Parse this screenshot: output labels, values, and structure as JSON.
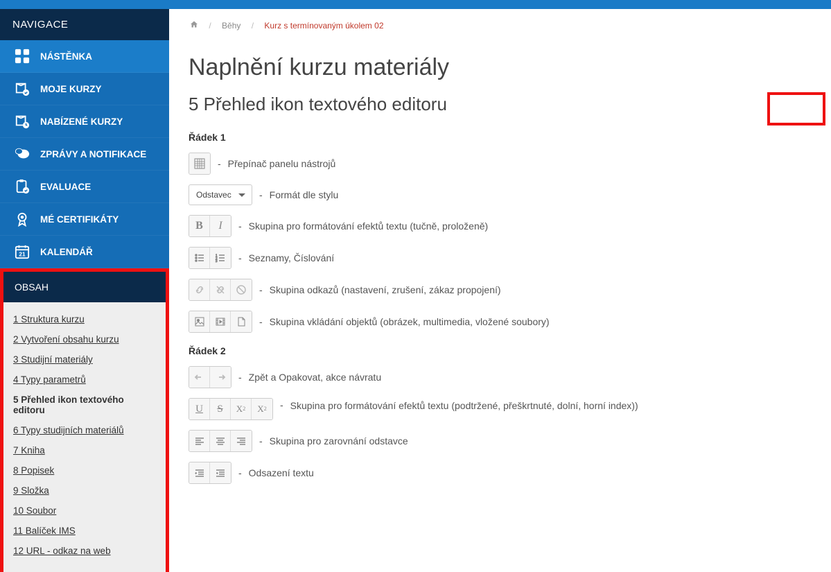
{
  "nav": {
    "title": "NAVIGACE",
    "items": [
      {
        "label": "NÁSTĚNKA",
        "icon": "grid"
      },
      {
        "label": "MOJE KURZY",
        "icon": "book-check"
      },
      {
        "label": "NABÍZENÉ KURZY",
        "icon": "book-clock"
      },
      {
        "label": "ZPRÁVY A NOTIFIKACE",
        "icon": "chat"
      },
      {
        "label": "EVALUACE",
        "icon": "clipboard"
      },
      {
        "label": "MÉ CERTIFIKÁTY",
        "icon": "award"
      },
      {
        "label": "KALENDÁŘ",
        "icon": "calendar"
      }
    ]
  },
  "obsah": {
    "title": "OBSAH",
    "items": [
      {
        "label": "1 Struktura kurzu"
      },
      {
        "label": "2 Vytvoření obsahu kurzu"
      },
      {
        "label": "3 Studijní materiály"
      },
      {
        "label": "4 Typy parametrů"
      },
      {
        "label": "5 Přehled ikon textového editoru",
        "current": true
      },
      {
        "label": "6 Typy studijních materiálů"
      },
      {
        "label": "7 Kniha"
      },
      {
        "label": "8 Popisek"
      },
      {
        "label": "9 Složka"
      },
      {
        "label": "10 Soubor"
      },
      {
        "label": "11 Balíček IMS"
      },
      {
        "label": "12 URL - odkaz na web"
      }
    ]
  },
  "breadcrumb": {
    "behy": "Běhy",
    "course": "Kurz s termínovaným úkolem 02"
  },
  "page": {
    "title": "Naplnění kurzu materiály",
    "subtitle": "5 Přehled ikon textového editoru"
  },
  "row1": {
    "title": "Řádek 1",
    "items": [
      {
        "desc": "Přepínač panelu nástrojů"
      },
      {
        "select": "Odstavec",
        "desc": "Formát dle stylu"
      },
      {
        "desc": "Skupina pro formátování efektů textu (tučně, proloženě)"
      },
      {
        "desc": "Seznamy, Číslování"
      },
      {
        "desc": "Skupina odkazů (nastavení, zrušení, zákaz propojení)"
      },
      {
        "desc": "Skupina vkládání objektů (obrázek, multimedia, vložené soubory)"
      }
    ]
  },
  "row2": {
    "title": "Řádek 2",
    "items": [
      {
        "desc": "Zpět a Opakovat, akce návratu"
      },
      {
        "desc": "Skupina pro formátování efektů textu (podtržené, přeškrtnuté, dolní, horní index))"
      },
      {
        "desc": "Skupina pro zarovnání odstavce"
      },
      {
        "desc": "Odsazení textu"
      }
    ]
  }
}
